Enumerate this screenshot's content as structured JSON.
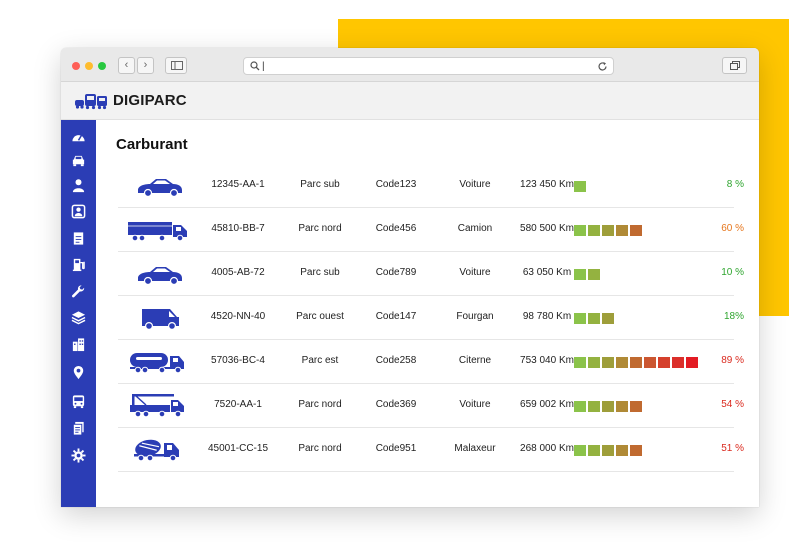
{
  "browser": {
    "url_value": "|",
    "url_placeholder": ""
  },
  "app": {
    "name": "DIGIPARC"
  },
  "page": {
    "title": "Carburant"
  },
  "sidebar_icons": [
    "dashboard-icon",
    "car-icon",
    "user-icon",
    "driver-icon",
    "document-icon",
    "fuel-pump-icon",
    "wrench-icon",
    "layers-icon",
    "buildings-icon",
    "location-pin-icon",
    "bus-icon",
    "documents-icon",
    "gear-icon"
  ],
  "colors": {
    "accent_blue": "#2B3DB5",
    "yellow": "#FFC600",
    "gauge": [
      "#8BC34A",
      "#94B240",
      "#9E9E3A",
      "#B08A36",
      "#C06A30",
      "#CB5630",
      "#D5402C",
      "#DB2F2A",
      "#E31B23"
    ],
    "pct_green": "#2FA52F",
    "pct_orange": "#E6771E",
    "pct_red": "#DA2A1F"
  },
  "vehicles": [
    {
      "icon": "car-icon",
      "plate": "12345-AA-1",
      "parc": "Parc sub",
      "code": "Code123",
      "type": "Voiture",
      "km": "123 450 Km",
      "gauge": 1,
      "pct": "8 %",
      "pct_color": "#2FA52F"
    },
    {
      "icon": "truck-icon",
      "plate": "45810-BB-7",
      "parc": "Parc nord",
      "code": "Code456",
      "type": "Camion",
      "km": "580 500 Km",
      "gauge": 5,
      "pct": "60 %",
      "pct_color": "#E6771E"
    },
    {
      "icon": "car-icon",
      "plate": "4005-AB-72",
      "parc": "Parc sub",
      "code": "Code789",
      "type": "Voiture",
      "km": "63 050 Km",
      "gauge": 2,
      "pct": "10 %",
      "pct_color": "#2FA52F"
    },
    {
      "icon": "van-icon",
      "plate": "4520-NN-40",
      "parc": "Parc ouest",
      "code": "Code147",
      "type": "Fourgan",
      "km": "98 780 Km",
      "gauge": 3,
      "pct": "18%",
      "pct_color": "#2FA52F"
    },
    {
      "icon": "tanker-truck-icon",
      "plate": "57036-BC-4",
      "parc": "Parc est",
      "code": "Code258",
      "type": "Citerne",
      "km": "753 040 Km",
      "gauge": 9,
      "pct": "89 %",
      "pct_color": "#DA2A1F"
    },
    {
      "icon": "crane-truck-icon",
      "plate": "7520-AA-1",
      "parc": "Parc nord",
      "code": "Code369",
      "type": "Voiture",
      "km": "659 002 Km",
      "gauge": 5,
      "pct": "54 %",
      "pct_color": "#DA2A1F"
    },
    {
      "icon": "mixer-truck-icon",
      "plate": "45001-CC-15",
      "parc": "Parc nord",
      "code": "Code951",
      "type": "Malaxeur",
      "km": "268 000 Km",
      "gauge": 5,
      "pct": "51 %",
      "pct_color": "#DA2A1F"
    }
  ]
}
